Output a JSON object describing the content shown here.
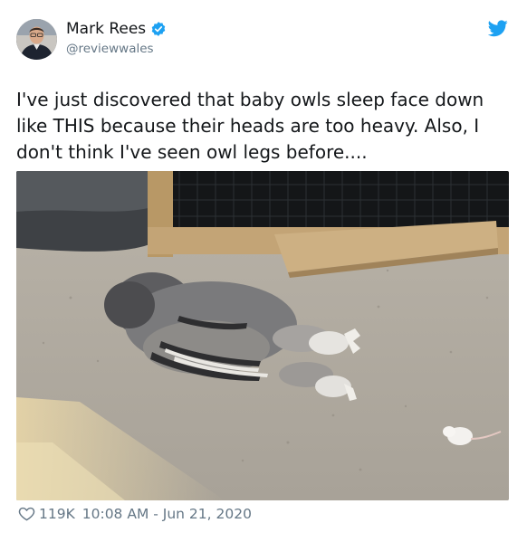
{
  "author": {
    "name": "Mark Rees",
    "handle": "@reviewwales",
    "verified": true
  },
  "tweet": {
    "text": "I've just discovered that baby owls sleep face down like THIS because their heads are too heavy. Also, I don't think I've seen owl legs before...."
  },
  "stats": {
    "likes": "119K",
    "timestamp": "10:08 AM - Jun 21, 2020"
  },
  "icons": {
    "brand": "twitter-bird-icon",
    "verified": "verified-badge-icon",
    "like": "heart-icon"
  },
  "colors": {
    "twitter_blue": "#1da1f2",
    "secondary_text": "#657786",
    "primary_text": "#14171a"
  }
}
